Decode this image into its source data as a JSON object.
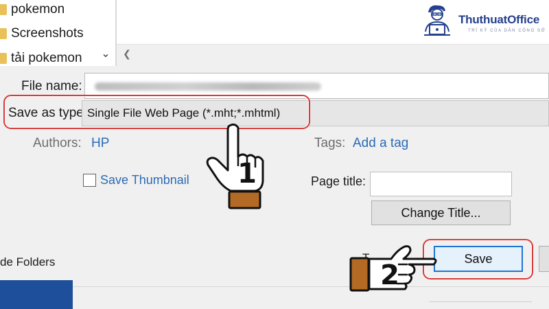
{
  "folder_tree": {
    "items": [
      {
        "label": "pokemon"
      },
      {
        "label": "Screenshots"
      },
      {
        "label": "tải pokemon"
      }
    ]
  },
  "icons": {
    "folder": "folder-icon",
    "tree_scroll_down": "chevron-down-icon",
    "hscroll_left": "chevron-left-icon",
    "step_hand": "pointing-hand-icon"
  },
  "form": {
    "file_name_label": "File name:",
    "save_as_type_label": "Save as type:",
    "save_as_type_value": "Single File Web Page (*.mht;*.mhtml)",
    "authors_label": "Authors:",
    "authors_value": "HP",
    "tags_label": "Tags:",
    "tags_placeholder": "Add a tag",
    "save_thumbnail_label": "Save Thumbnail",
    "save_thumbnail_checked": false,
    "page_title_label": "Page title:",
    "page_title_value": ""
  },
  "buttons": {
    "change_title": "Change Title...",
    "save": "Save"
  },
  "footer": {
    "hide_folders_label": "de Folders",
    "partial_text": "T"
  },
  "annotations": {
    "step_1": "1",
    "step_2": "2"
  },
  "logo": {
    "name": "ThuthuatOffice",
    "tagline": "TRÍ KỸ CỦA DÂN CÔNG SỞ"
  },
  "colors": {
    "highlight": "#d63a3a",
    "link": "#2a6bb5",
    "save_button_border": "#1f74d1",
    "logo_primary": "#24408e",
    "hand_cuff": "#b36a24",
    "bottom_block": "#1d4f9a"
  }
}
